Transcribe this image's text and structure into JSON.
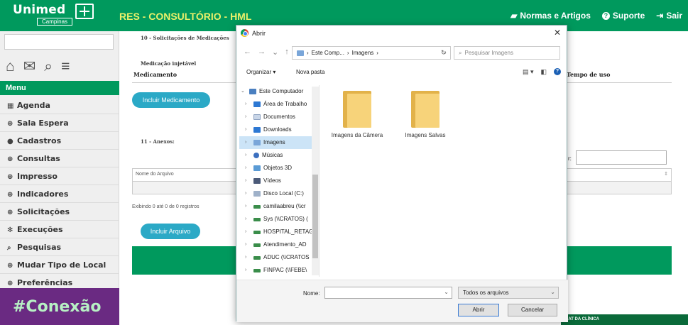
{
  "header": {
    "logo_text": "Unimed",
    "logo_sub": "Campinas",
    "app_title": "RES - CONSULTÓRIO - HML",
    "links": [
      {
        "label": "Normas e Artigos",
        "icon": "book-icon"
      },
      {
        "label": "Suporte",
        "icon": "question-circle-icon"
      },
      {
        "label": "Sair",
        "icon": "sign-out-icon"
      }
    ]
  },
  "sidebar": {
    "menu_title": "Menu",
    "items": [
      {
        "label": "Agenda",
        "icon": "calendar-icon",
        "glyph": "▦"
      },
      {
        "label": "Sala Espera",
        "icon": "plus-circle-icon",
        "glyph": "⊕"
      },
      {
        "label": "Cadastros",
        "icon": "record-icon",
        "glyph": "●"
      },
      {
        "label": "Consultas",
        "icon": "plus-circle-icon",
        "glyph": "⊕"
      },
      {
        "label": "Impresso",
        "icon": "plus-circle-icon",
        "glyph": "⊕"
      },
      {
        "label": "Indicadores",
        "icon": "plus-circle-icon",
        "glyph": "⊕"
      },
      {
        "label": "Solicitações",
        "icon": "plus-circle-icon",
        "glyph": "⊕"
      },
      {
        "label": "Execuções",
        "icon": "gears-icon",
        "glyph": "✻"
      },
      {
        "label": "Pesquisas",
        "icon": "search-icon",
        "glyph": "⌕"
      },
      {
        "label": "Mudar Tipo de Local",
        "icon": "plus-circle-icon",
        "glyph": "⊕"
      },
      {
        "label": "Preferências",
        "icon": "plus-circle-icon",
        "glyph": "⊕"
      }
    ],
    "banner_text": "#Conexão"
  },
  "main": {
    "section10_title": "10 - Solicitações de Medicações",
    "medicacao_label": "Medicação injetável",
    "col_medicamento": "Medicamento",
    "col_tempo": "Tempo de uso",
    "btn_incluir_medicamento": "Incluir Medicamento",
    "section11_title": "11 - Anexos:",
    "filter_label": "r:",
    "col_nome_arquivo": "Nome do Arquivo",
    "exibindo": "Exibindo 0 até 0 de 0 registros",
    "btn_incluir_arquivo": "Incluir Arquivo",
    "chat_label": "HAT DA CLÍNICA"
  },
  "dialog": {
    "title": "Abrir",
    "address_parts": [
      "Este Comp...",
      "Imagens"
    ],
    "search_placeholder": "Pesquisar Imagens",
    "organize_label": "Organizar ▾",
    "new_folder_label": "Nova pasta",
    "tree": [
      {
        "label": "Este Computador",
        "icon": "computer-icon",
        "cls": "pc",
        "root": true
      },
      {
        "label": "Área de Trabalho",
        "icon": "desktop-folder-icon",
        "cls": "blue"
      },
      {
        "label": "Documentos",
        "icon": "documents-icon",
        "cls": "doc"
      },
      {
        "label": "Downloads",
        "icon": "downloads-icon",
        "cls": "blue"
      },
      {
        "label": "Imagens",
        "icon": "pictures-icon",
        "cls": "img",
        "selected": true
      },
      {
        "label": "Músicas",
        "icon": "music-icon",
        "cls": "music"
      },
      {
        "label": "Objetos 3D",
        "icon": "objects-3d-icon",
        "cls": "obj"
      },
      {
        "label": "Vídeos",
        "icon": "videos-icon",
        "cls": "vid"
      },
      {
        "label": "Disco Local (C:)",
        "icon": "disk-icon",
        "cls": "disk"
      },
      {
        "label": "camilaabreu (\\\\cr",
        "icon": "network-drive-icon",
        "cls": "net"
      },
      {
        "label": "Sys (\\\\CRATOS) (",
        "icon": "network-drive-icon",
        "cls": "net"
      },
      {
        "label": "HOSPITAL_RETAG",
        "icon": "network-drive-icon",
        "cls": "net"
      },
      {
        "label": "Atendimento_AD",
        "icon": "network-drive-icon",
        "cls": "net"
      },
      {
        "label": "ADUC (\\\\CRATOS",
        "icon": "network-drive-icon",
        "cls": "net"
      },
      {
        "label": "FINPAC (\\\\FEBE\\",
        "icon": "network-drive-icon",
        "cls": "net"
      }
    ],
    "folders": [
      {
        "label": "Imagens da Câmera"
      },
      {
        "label": "Imagens Salvas"
      }
    ],
    "filename_label": "Nome:",
    "filename_value": "",
    "filetype_value": "Todos os arquivos",
    "btn_open": "Abrir",
    "btn_cancel": "Cancelar"
  }
}
